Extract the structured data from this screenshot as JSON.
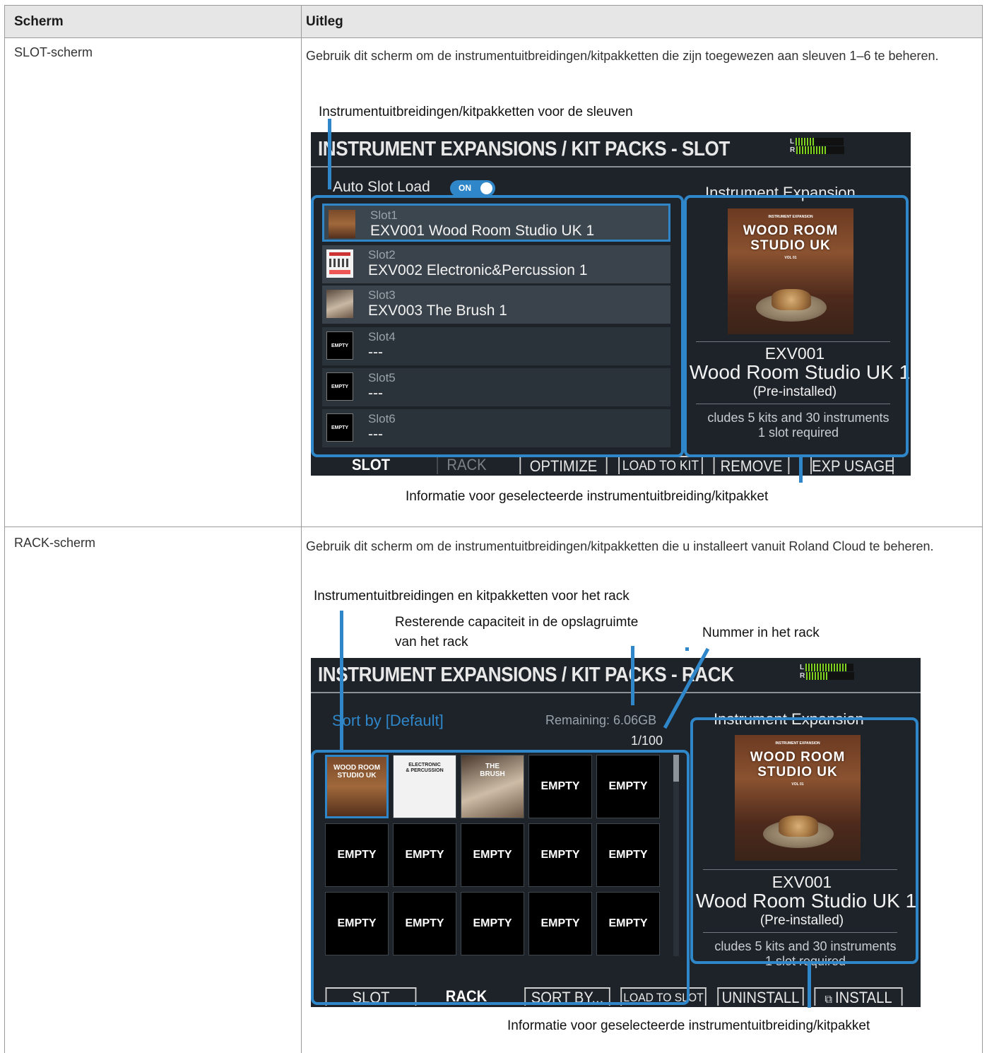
{
  "table": {
    "headers": [
      "Scherm",
      "Uitleg"
    ],
    "rows": [
      {
        "screen": "SLOT-scherm",
        "description": "Gebruik dit scherm om de instrumentuitbreidingen/kitpakketten die zijn toegewezen aan sleuven 1–6 te beheren.",
        "callout_top": "Instrumentuitbreidingen/kitpakketten voor de sleuven",
        "callout_bottom": "Informatie voor geselecteerde instrumentuitbreiding/kitpakket"
      },
      {
        "screen": "RACK-scherm",
        "description": "Gebruik dit scherm om de instrumentuitbreidingen/kitpakketten die u installeert vanuit Roland Cloud te beheren.",
        "callout_top": "Instrumentuitbreidingen en kitpakketten voor het rack",
        "callout_remaining": [
          "Resterende capaciteit in de opslagruimte",
          "van het rack"
        ],
        "callout_number": "Nummer in het rack",
        "callout_bottom": "Informatie voor geselecteerde instrumentuitbreiding/kitpakket"
      }
    ]
  },
  "slot_screen": {
    "title": "INSTRUMENT EXPANSIONS / KIT PACKS - SLOT",
    "meter_left": "L",
    "meter_right": "R",
    "auto_slot_label": "Auto Slot Load",
    "auto_slot_toggle": "ON",
    "pane_heading": "Instrument Expansion",
    "slots": [
      {
        "label": "Slot1",
        "name": "EXV001  Wood Room Studio UK 1"
      },
      {
        "label": "Slot2",
        "name": "EXV002 Electronic&Percussion 1"
      },
      {
        "label": "Slot3",
        "name": "EXV003 The Brush 1"
      },
      {
        "label": "Slot4",
        "name": "---",
        "thumb": "EMPTY"
      },
      {
        "label": "Slot5",
        "name": "---",
        "thumb": "EMPTY"
      },
      {
        "label": "Slot6",
        "name": "---",
        "thumb": "EMPTY"
      }
    ],
    "art": {
      "top": "INSTRUMENT EXPANSION",
      "line1": "WOOD ROOM",
      "line2": "STUDIO UK",
      "vol": "VOL 01"
    },
    "info": {
      "code": "EXV001",
      "name": "Wood Room Studio UK 1",
      "status": "(Pre-installed)",
      "includes": "cludes 5 kits and 30 instruments",
      "required": "1 slot required"
    },
    "tabs": [
      "SLOT",
      "RACK",
      "OPTIMIZE",
      "LOAD TO KIT",
      "REMOVE",
      "EXP USAGE"
    ]
  },
  "rack_screen": {
    "title": "INSTRUMENT EXPANSIONS / KIT PACKS - RACK",
    "meter_left": "L",
    "meter_right": "R",
    "sort_label": "Sort by [Default]",
    "remaining": "Remaining: 6.06GB",
    "counter": "1/100",
    "pane_heading": "Instrument Expansion",
    "cells": [
      "",
      "",
      "",
      "EMPTY",
      "EMPTY",
      "EMPTY",
      "EMPTY",
      "EMPTY",
      "EMPTY",
      "EMPTY",
      "EMPTY",
      "EMPTY",
      "EMPTY",
      "EMPTY",
      "EMPTY"
    ],
    "thumb_texts": {
      "wood": [
        "WOOD ROOM",
        "STUDIO UK"
      ],
      "electronic": [
        "ELECTRONIC",
        "& PERCUSSION"
      ],
      "brush": [
        "THE",
        "BRUSH"
      ]
    },
    "art": {
      "top": "INSTRUMENT EXPANSION",
      "line1": "WOOD ROOM",
      "line2": "STUDIO UK",
      "vol": "VOL 01"
    },
    "info": {
      "code": "EXV001",
      "name": "Wood Room Studio UK 1",
      "status": "(Pre-installed)",
      "includes": "cludes 5 kits and 30 instruments",
      "required": "1 slot required"
    },
    "tabs": [
      "SLOT",
      "RACK",
      "SORT BY...",
      "LOAD TO SLOT",
      "UNINSTALL",
      "INSTALL"
    ]
  }
}
